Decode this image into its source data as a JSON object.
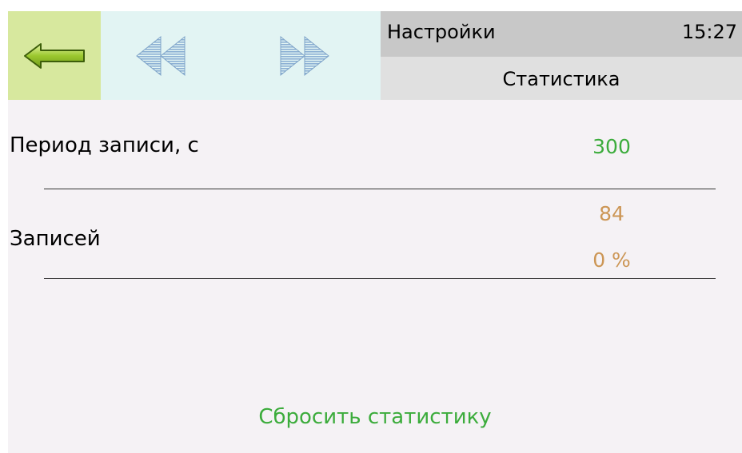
{
  "header": {
    "title": "Настройки",
    "time": "15:27",
    "subtitle": "Статистика",
    "back_icon": "arrow-left-icon",
    "prev_icon": "rewind-icon",
    "next_icon": "fast-forward-icon"
  },
  "rows": [
    {
      "label": "Период записи, с",
      "value": "300"
    },
    {
      "label": "Записей",
      "value": "84",
      "percent": "0 %"
    }
  ],
  "actions": {
    "reset_label": "Сбросить статистику"
  },
  "colors": {
    "accent_green": "#3cac3c",
    "value_orange": "#cc9655",
    "back_button_bg": "#d7e89e",
    "nav_bg": "#e2f4f3",
    "title_bg": "#c8c8c8",
    "subtitle_bg": "#e0e0e0",
    "screen_bg": "#f5f2f5"
  }
}
